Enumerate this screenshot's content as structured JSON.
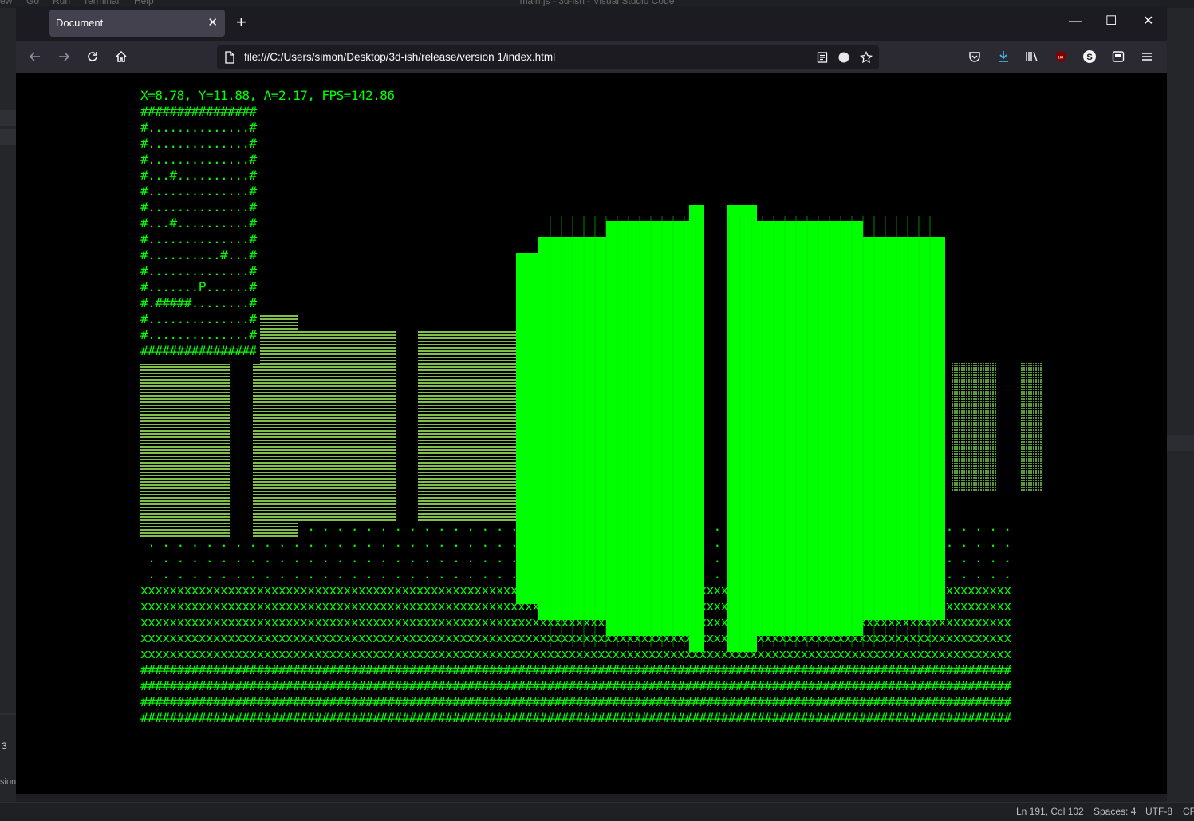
{
  "vscode": {
    "menu": [
      "ew",
      "Go",
      "Run",
      "Terminal",
      "Help"
    ],
    "title": "main.js - 3d-ish - Visual Studio Code",
    "gutter_number": "3",
    "sidebar_fragment": "sion",
    "status": {
      "position": "Ln 191, Col 102",
      "spaces": "Spaces: 4",
      "encoding": "UTF-8",
      "eol": "CR"
    }
  },
  "browser": {
    "tab_title": "Document",
    "url": "file:///C:/Users/simon/Desktop/3d-ish/release/version 1/index.html"
  },
  "game": {
    "hud": "X=8.78, Y=11.88, A=2.17, FPS=142.86",
    "minimap": [
      "################",
      "#..............#",
      "#..............#",
      "#..............#",
      "#...#..........#",
      "#..............#",
      "#..............#",
      "#...#..........#",
      "#..............#",
      "#..........#...#",
      "#..............#",
      "#.......P......#",
      "#.#####........#",
      "#..............#",
      "#..............#",
      "################"
    ],
    "floor_chars": [
      ".",
      "x",
      "#"
    ],
    "wall_color": "#00ff00",
    "far_wall_color": "#7fbf4a"
  }
}
